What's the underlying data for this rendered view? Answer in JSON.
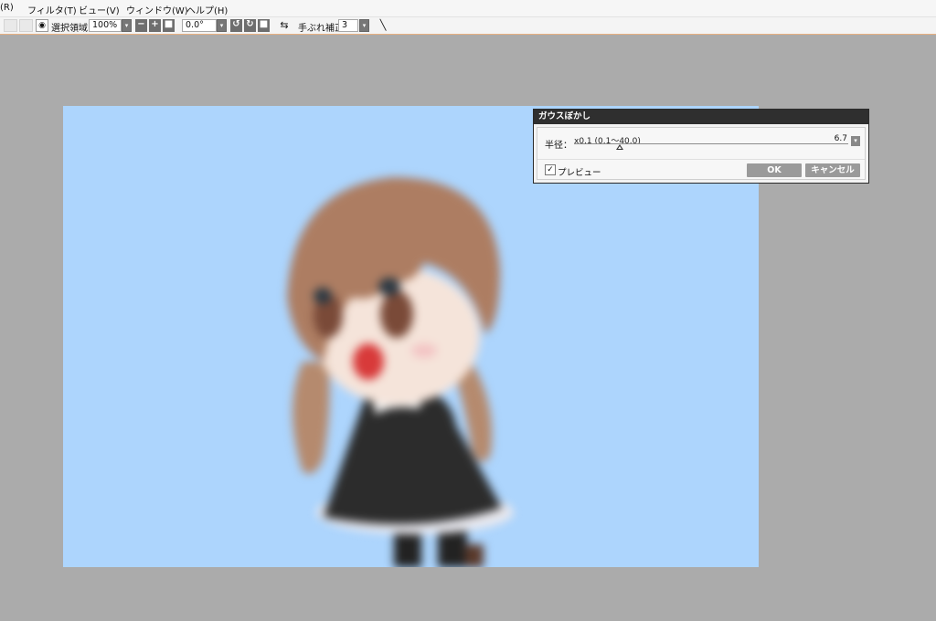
{
  "menu": {
    "items": [
      {
        "label": "(R)"
      },
      {
        "label": "フィルタ(T)"
      },
      {
        "label": "ビュー(V)"
      },
      {
        "label": "ウィンドウ(W)"
      },
      {
        "label": "ヘルプ(H)"
      }
    ]
  },
  "toolbar": {
    "selection_label": "選択領域",
    "zoom_value": "100%",
    "rotation_value": "0.0°",
    "stabilizer_label": "手ぶれ補正",
    "stabilizer_value": "3",
    "swap_icon": "⇆",
    "eye_icon": "👁"
  },
  "dialog": {
    "title": "ガウスぼかし",
    "radius_label": "半径：",
    "slider_caption": "x0.1 (0.1～40.0)",
    "radius_value": "6.7",
    "preview_label": "プレビュー",
    "preview_checked": true,
    "ok_label": "OK",
    "cancel_label": "キャンセル",
    "slider_level": 0.167
  },
  "colors": {
    "canvas_bg": "#add5fd",
    "workspace": "#ababab",
    "accent_line": "#e8b080"
  }
}
